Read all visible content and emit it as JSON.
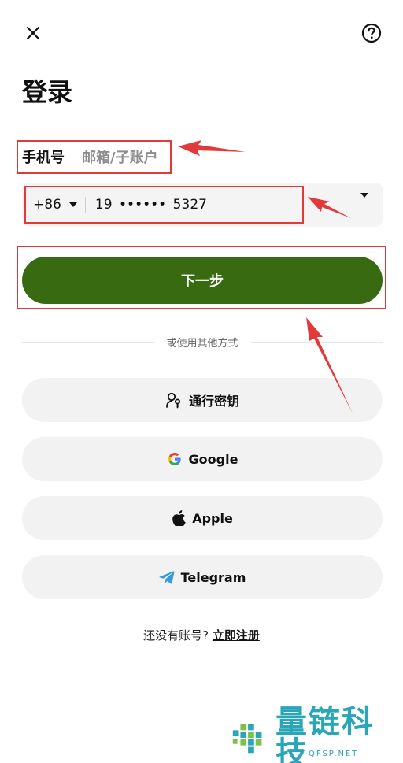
{
  "header": {
    "close_icon": "close-icon",
    "help_icon": "help-circle-icon"
  },
  "title": "登录",
  "tabs": [
    {
      "label": "手机号",
      "active": true
    },
    {
      "label": "邮箱/子账户",
      "active": false
    }
  ],
  "phone": {
    "country_code": "+86",
    "value": "19 •••••• 5327"
  },
  "primary_button": "下一步",
  "divider_text": "或使用其他方式",
  "alt_logins": [
    {
      "label": "通行密钥",
      "icon": "passkey-icon"
    },
    {
      "label": "Google",
      "icon": "google-icon"
    },
    {
      "label": "Apple",
      "icon": "apple-icon"
    },
    {
      "label": "Telegram",
      "icon": "telegram-icon"
    }
  ],
  "signup": {
    "prompt": "还没有账号?",
    "link": "立即注册"
  },
  "watermark": {
    "text": "量链科技",
    "subtext": "QFSP.NET"
  },
  "colors": {
    "primary": "#376a11",
    "annotation": "#e23a3a",
    "watermark": "#2aa6b8"
  }
}
